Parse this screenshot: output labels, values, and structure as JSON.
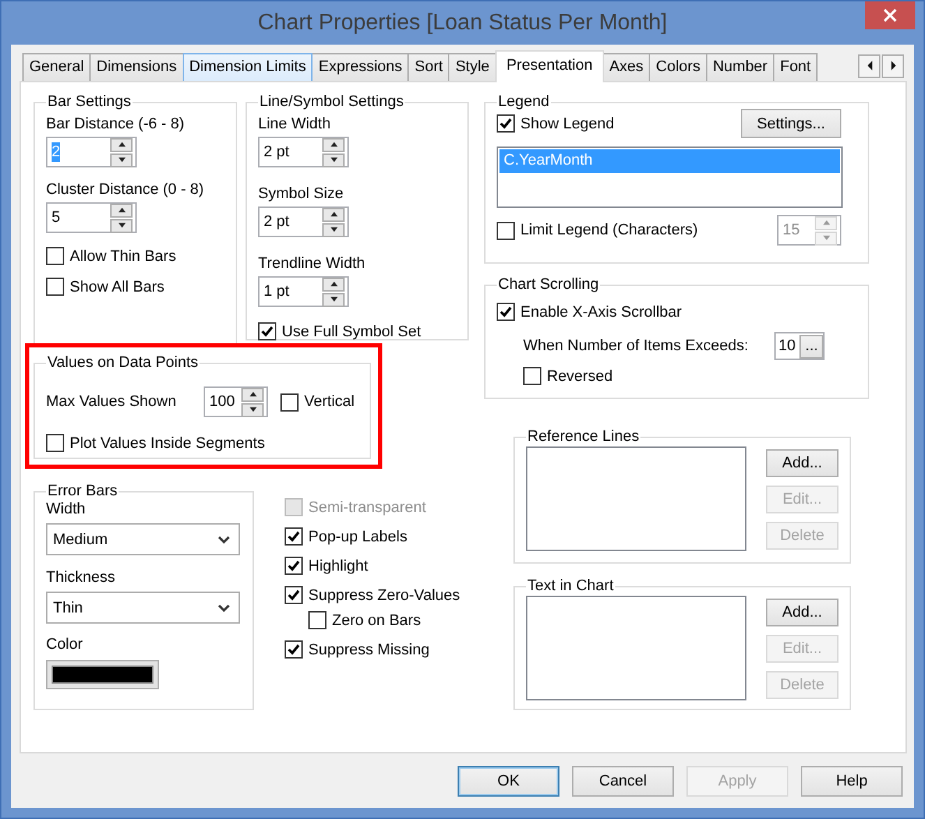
{
  "window": {
    "title": "Chart Properties [Loan Status Per Month]"
  },
  "tabs": [
    {
      "label": "General",
      "selected": false,
      "hovered": false
    },
    {
      "label": "Dimensions",
      "selected": false,
      "hovered": false
    },
    {
      "label": "Dimension Limits",
      "selected": false,
      "hovered": true
    },
    {
      "label": "Expressions",
      "selected": false,
      "hovered": false
    },
    {
      "label": "Sort",
      "selected": false,
      "hovered": false
    },
    {
      "label": "Style",
      "selected": false,
      "hovered": false
    },
    {
      "label": "Presentation",
      "selected": true,
      "hovered": false
    },
    {
      "label": "Axes",
      "selected": false,
      "hovered": false
    },
    {
      "label": "Colors",
      "selected": false,
      "hovered": false
    },
    {
      "label": "Number",
      "selected": false,
      "hovered": false
    },
    {
      "label": "Font",
      "selected": false,
      "hovered": false
    }
  ],
  "bar_settings": {
    "title": "Bar Settings",
    "fields": [
      {
        "label": "Bar Distance (-6 - 8)",
        "value": "2",
        "text_selected": true
      },
      {
        "label": "Cluster Distance (0 - 8)",
        "value": "5",
        "text_selected": false
      }
    ],
    "checkboxes": [
      {
        "label": "Allow Thin Bars",
        "checked": false
      },
      {
        "label": "Show All Bars",
        "checked": false
      }
    ]
  },
  "line_symbol_settings": {
    "title": "Line/Symbol Settings",
    "fields": [
      {
        "label": "Line Width",
        "value": "2 pt",
        "text_selected": false
      },
      {
        "label": "Symbol Size",
        "value": "2 pt",
        "text_selected": false
      },
      {
        "label": "Trendline Width",
        "value": "1 pt",
        "text_selected": false
      }
    ],
    "checkboxes": [
      {
        "label": "Use Full Symbol Set",
        "checked": true
      }
    ]
  },
  "values_on_data_points": {
    "highlighted": true,
    "title": "Values on Data Points",
    "max_values_label": "Max Values Shown",
    "max_values": "100",
    "checkboxes": [
      {
        "label": "Vertical",
        "checked": false
      },
      {
        "label": "Plot Values Inside Segments",
        "checked": false
      }
    ]
  },
  "error_bars": {
    "title": "Error Bars",
    "width_label": "Width",
    "width": "Medium",
    "thickness_label": "Thickness",
    "thickness": "Thin",
    "color_label": "Color",
    "color": "#000000"
  },
  "display_options": [
    {
      "label": "Semi-transparent",
      "checked": false,
      "disabled": true
    },
    {
      "label": "Pop-up Labels",
      "checked": true,
      "disabled": false
    },
    {
      "label": "Highlight",
      "checked": true,
      "disabled": false
    },
    {
      "label": "Suppress Zero-Values",
      "checked": true,
      "disabled": false,
      "children": [
        {
          "label": "Zero on Bars",
          "checked": false,
          "disabled": false
        }
      ]
    },
    {
      "label": "Suppress Missing",
      "checked": true,
      "disabled": false
    }
  ],
  "legend": {
    "title": "Legend",
    "show_legend": {
      "label": "Show Legend",
      "checked": true
    },
    "settings_button": "Settings...",
    "items": [
      {
        "label": "C.YearMonth",
        "selected": true
      }
    ],
    "limit": {
      "label": "Limit Legend (Characters)",
      "checked": false
    },
    "limit_value": {
      "value": "15",
      "disabled": true
    }
  },
  "chart_scrolling": {
    "title": "Chart Scrolling",
    "enable": {
      "label": "Enable X-Axis Scrollbar",
      "checked": true
    },
    "threshold_label": "When Number of Items Exceeds:",
    "threshold": "10",
    "threshold_button": "...",
    "reversed": {
      "label": "Reversed",
      "checked": false
    }
  },
  "reference_lines": {
    "title": "Reference Lines",
    "buttons": [
      {
        "label": "Add...",
        "disabled": false
      },
      {
        "label": "Edit...",
        "disabled": true
      },
      {
        "label": "Delete",
        "disabled": true
      }
    ]
  },
  "text_in_chart": {
    "title": "Text in Chart",
    "buttons": [
      {
        "label": "Add...",
        "disabled": false
      },
      {
        "label": "Edit...",
        "disabled": true
      },
      {
        "label": "Delete",
        "disabled": true
      }
    ]
  },
  "buttons": [
    {
      "label": "OK",
      "default": true,
      "disabled": false
    },
    {
      "label": "Cancel",
      "default": false,
      "disabled": false
    },
    {
      "label": "Apply",
      "default": false,
      "disabled": true
    },
    {
      "label": "Help",
      "default": false,
      "disabled": false
    }
  ]
}
